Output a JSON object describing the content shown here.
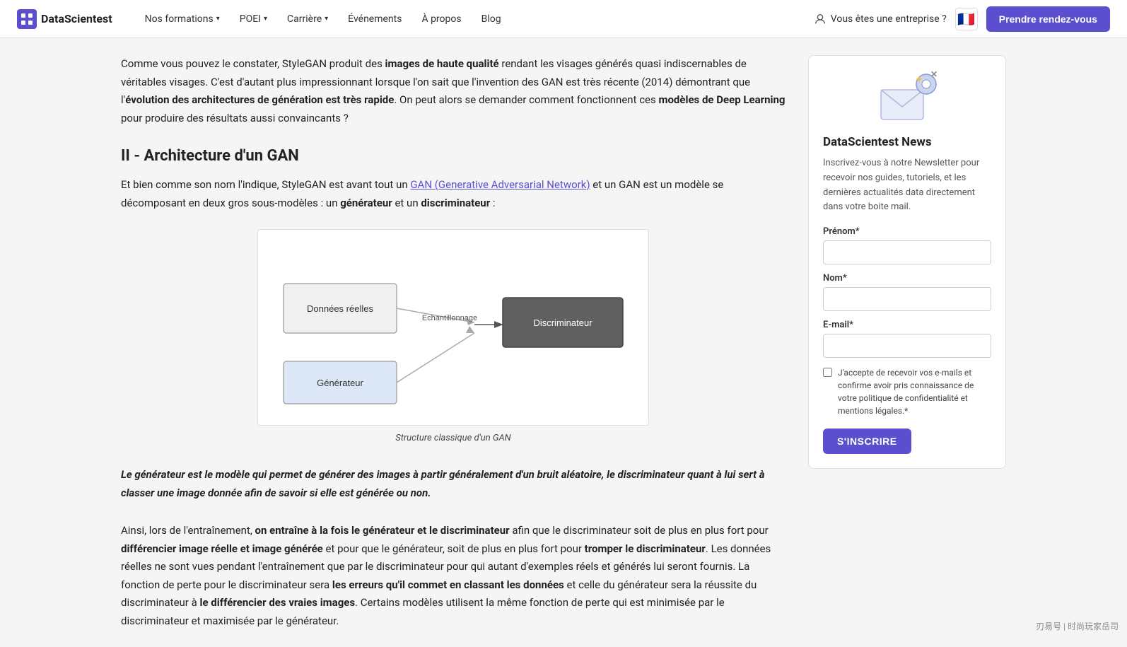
{
  "nav": {
    "logo_text": "DataScientest",
    "links": [
      {
        "label": "Nos formations",
        "has_dropdown": true
      },
      {
        "label": "POEI",
        "has_dropdown": true
      },
      {
        "label": "Carrière",
        "has_dropdown": true
      },
      {
        "label": "Événements",
        "has_dropdown": false
      },
      {
        "label": "À propos",
        "has_dropdown": false
      },
      {
        "label": "Blog",
        "has_dropdown": false
      }
    ],
    "enterprise_label": "Vous êtes une entreprise ?",
    "cta_label": "Prendre rendez-vous"
  },
  "article": {
    "intro_paragraph": "Comme vous pouvez le constater, StyleGAN produit des ",
    "intro_bold1": "images de haute qualité",
    "intro_mid1": " rendant les visages générés quasi indiscernables de véritables visages. C'est d'autant plus impressionnant lorsque l'on sait que l'invention des GAN est très récente (2014) démontrant que l'",
    "intro_bold2": "évolution des architectures de génération est très rapide",
    "intro_mid2": ". On peut alors se demander comment fonctionnent ces ",
    "intro_bold3": "modèles de Deep Learning",
    "intro_end": " pour produire des résultats aussi convaincants ?",
    "section_title": "II - Architecture d'un GAN",
    "section_intro_start": "Et bien comme son nom l'indique, StyleGAN est avant tout un ",
    "section_link_text": "GAN (Generative Adversarial Network)",
    "section_intro_mid": " et un GAN est un modèle se décomposant en deux gros sous-modèles : un ",
    "section_bold1": "générateur",
    "section_intro_end": " et un ",
    "section_bold2": "discriminateur",
    "section_colon": " :",
    "diagram_caption": "Structure classique d'un GAN",
    "diagram": {
      "donnees_label": "Données réelles",
      "generateur_label": "Générateur",
      "discriminateur_label": "Discriminateur",
      "echantillonnage_label": "Echantillonnage"
    },
    "highlight_text": "Le générateur est le modèle qui permet de générer des images à partir généralement d'un bruit aléatoire, le discriminateur quant à lui sert à classer une image donnée afin de savoir si elle est générée ou non.",
    "body_para": "Ainsi, lors de l'entraînement, ",
    "body_bold1": "on entraîne à la fois le générateur et le discriminateur",
    "body_mid1": " afin que le discriminateur soit de plus en plus fort pour ",
    "body_bold2": "différencier image réelle et image générée",
    "body_mid2": " et pour que le générateur, soit de plus en plus fort pour ",
    "body_bold3": "tromper le discriminateur",
    "body_mid3": ". Les données réelles ne sont vues pendant l'entraînement que par le discriminateur pour qui autant d'exemples réels et générés lui seront fournis. La fonction de perte pour le discriminateur sera ",
    "body_bold4": "les erreurs qu'il commet en classant les données",
    "body_mid4": " et celle du générateur sera la réussite du discriminateur à ",
    "body_bold5": "le différencier des vraies images",
    "body_end": ". Certains modèles utilisent la même fonction de perte qui est minimisée par le discriminateur et maximisée par le générateur."
  },
  "sidebar": {
    "newsletter_title": "DataScientest News",
    "newsletter_desc": "Inscrivez-vous à notre Newsletter pour recevoir nos guides, tutoriels, et les dernières actualités data directement dans votre boite mail.",
    "prenom_label": "Prénom*",
    "prenom_placeholder": "",
    "nom_label": "Nom*",
    "nom_placeholder": "",
    "email_label": "E-mail*",
    "email_placeholder": "",
    "checkbox_text": "J'accepte de recevoir vos e-mails et confirme avoir pris connaissance de votre politique de confidentialité et mentions légales.*",
    "subscribe_label": "S'INSCRIRE"
  },
  "watermark": "刃易号 | 时尚玩家岳司"
}
